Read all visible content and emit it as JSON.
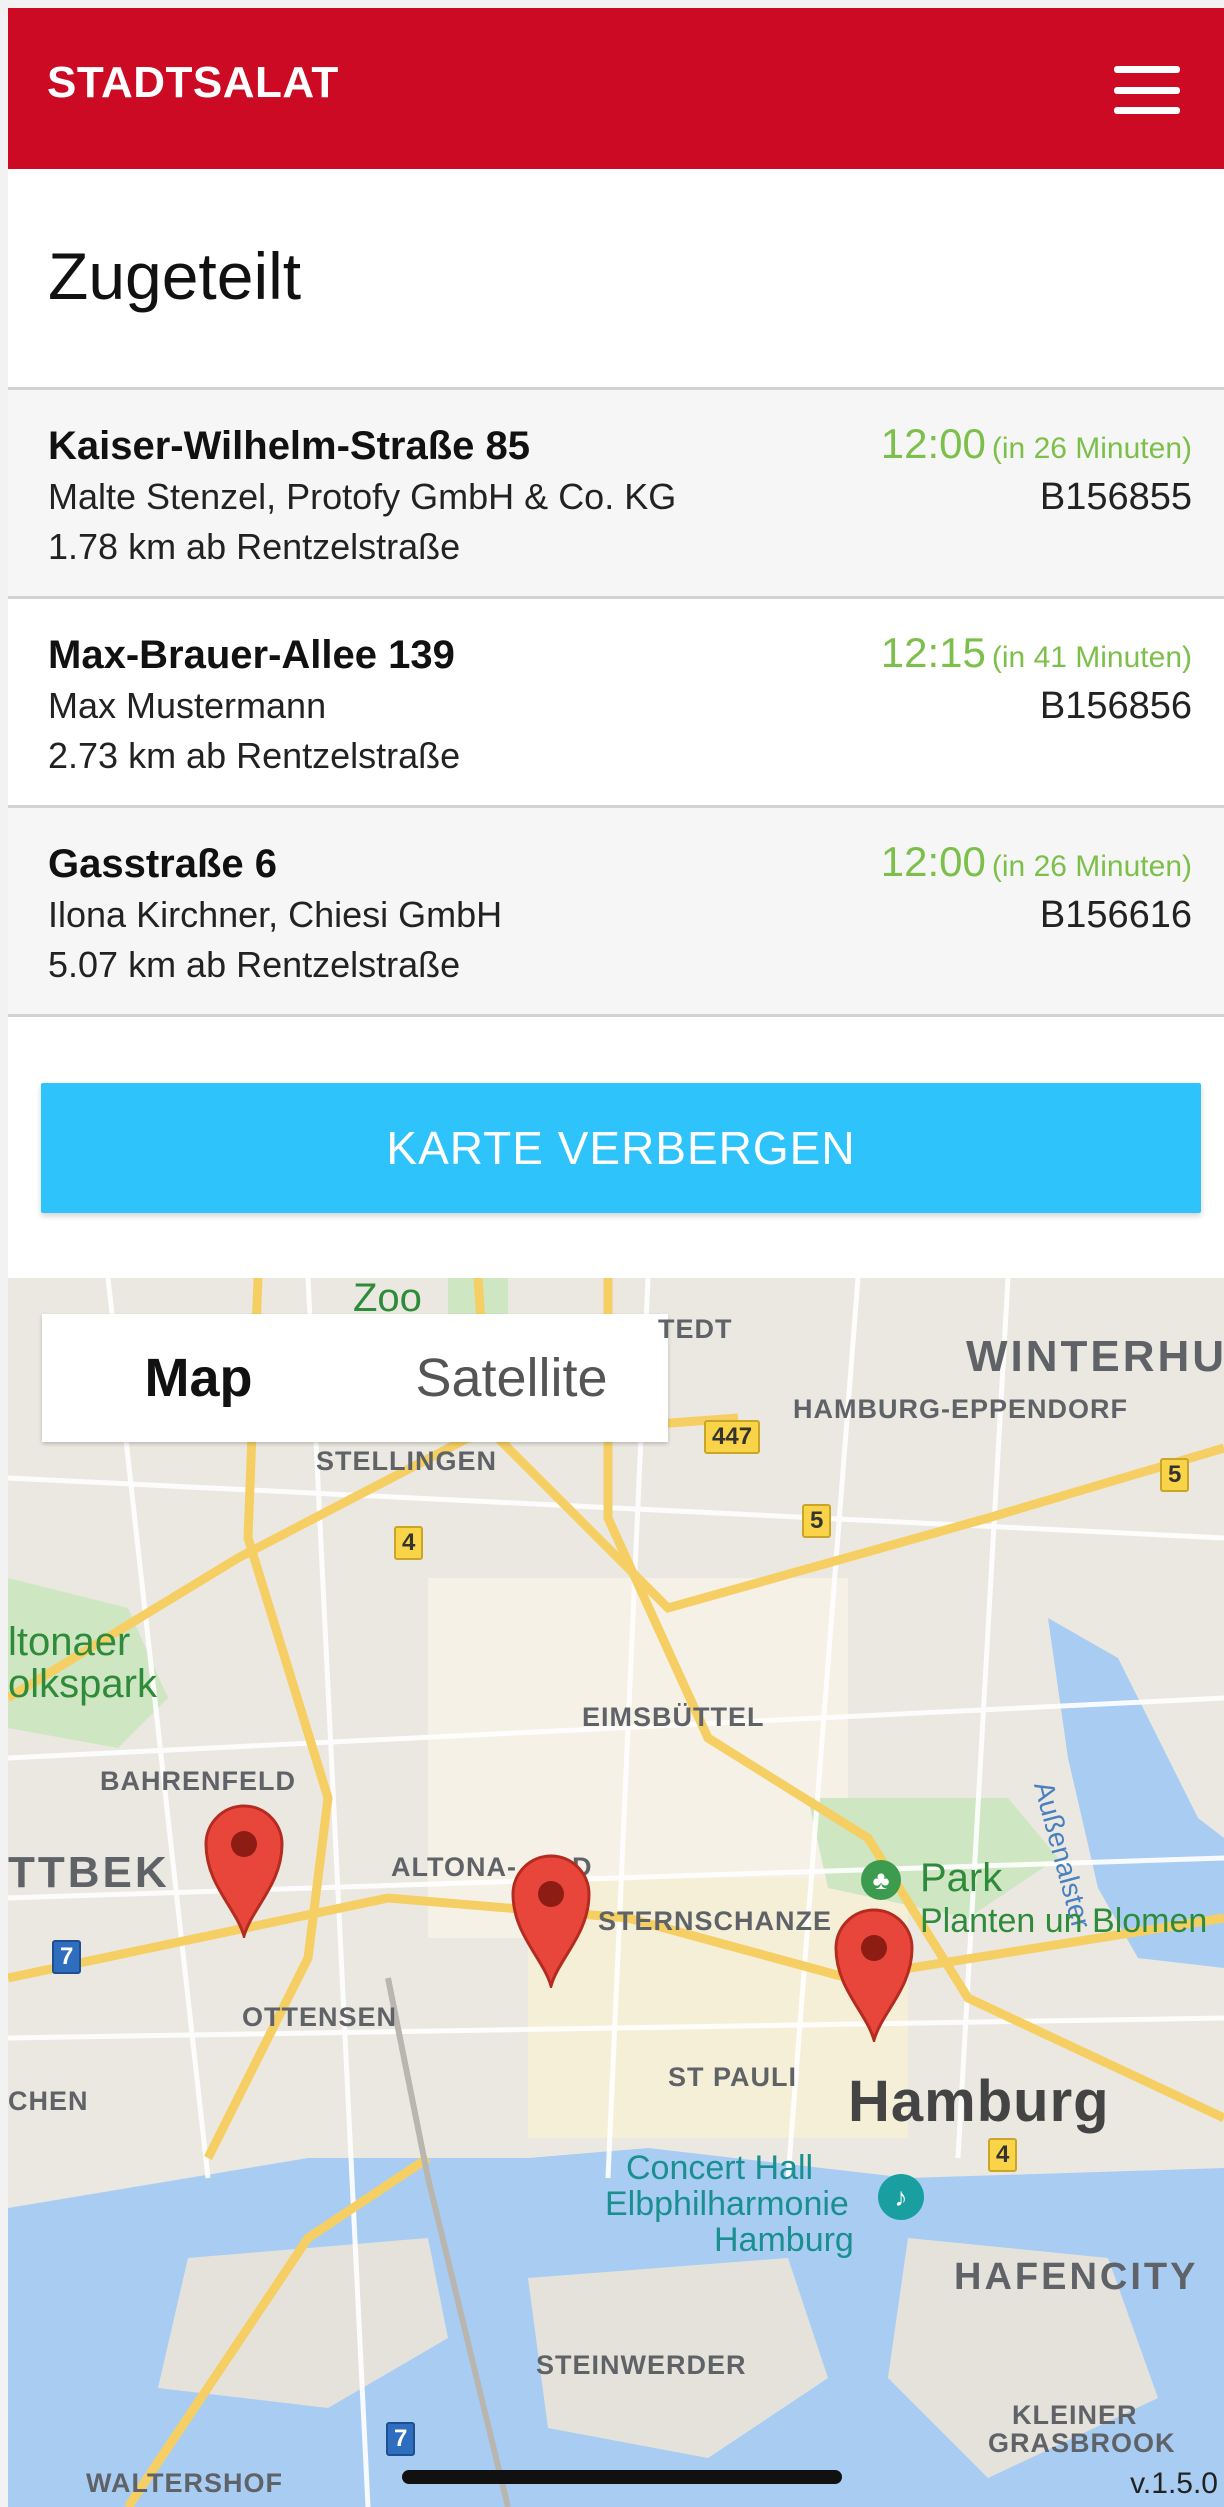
{
  "header": {
    "brand": "STADTSALAT",
    "menu_icon": "hamburger-menu-icon",
    "color": "#cc0a23"
  },
  "section": {
    "title": "Zugeteilt"
  },
  "orders": [
    {
      "address": "Kaiser-Wilhelm-Straße 85",
      "client": "Malte Stenzel, Protofy GmbH & Co. KG",
      "distance": "1.78 km ab Rentzelstraße",
      "time": "12:00",
      "relative": "(in 26 Minuten)",
      "code": "B156855"
    },
    {
      "address": "Max-Brauer-Allee 139",
      "client": "Max Mustermann",
      "distance": "2.73 km ab Rentzelstraße",
      "time": "12:15",
      "relative": "(in 41 Minuten)",
      "code": "B156856"
    },
    {
      "address": "Gasstraße 6",
      "client": "Ilona Kirchner, Chiesi GmbH",
      "distance": "5.07 km ab Rentzelstraße",
      "time": "12:00",
      "relative": "(in 26 Minuten)",
      "code": "B156616"
    }
  ],
  "toggle_map_button": {
    "label": "KARTE VERBERGEN",
    "color": "#2ec4fb"
  },
  "map": {
    "type_control": {
      "map": "Map",
      "satellite": "Satellite",
      "selected": "Map"
    },
    "labels": {
      "zoo": "Zoo",
      "tedt": "TEDT",
      "winterhude": "WINTERHU",
      "eppendorf": "HAMBURG-EPPENDORF",
      "stellingen": "STELLINGEN",
      "altonaer1": "ltonaer",
      "altonaer2": "olkspark",
      "eimsbuettel": "EIMSBÜTTEL",
      "aussenalster": "Außenalster",
      "bahrenfeld": "BAHRENFELD",
      "ttbek": "TTBEK",
      "altona": "ALTONA-",
      "altona_tail": "D",
      "sternschanze": "STERNSCHANZE",
      "park1": "Park",
      "park2": "Planten un Blomen",
      "ottensen": "OTTENSEN",
      "chen": "CHEN",
      "stpauli": "ST PAULI",
      "hamburg": "Hamburg",
      "concert1": "Concert Hall",
      "concert2": "Elbphilharmonie",
      "concert3": "Hamburg",
      "hafencity": "HAFENCITY",
      "steinwerder": "STEINWERDER",
      "kleiner1": "KLEINER",
      "kleiner2": "GRASBROOK",
      "waltershof": "WALTERSHOF"
    },
    "shields": {
      "s447": "447",
      "s5a": "5",
      "s5b": "5",
      "s4a": "4",
      "s4b": "4",
      "s7a": "7",
      "s7b": "7"
    },
    "markers": [
      "marker-1",
      "marker-2",
      "marker-3"
    ]
  },
  "version": "v.1.5.0"
}
